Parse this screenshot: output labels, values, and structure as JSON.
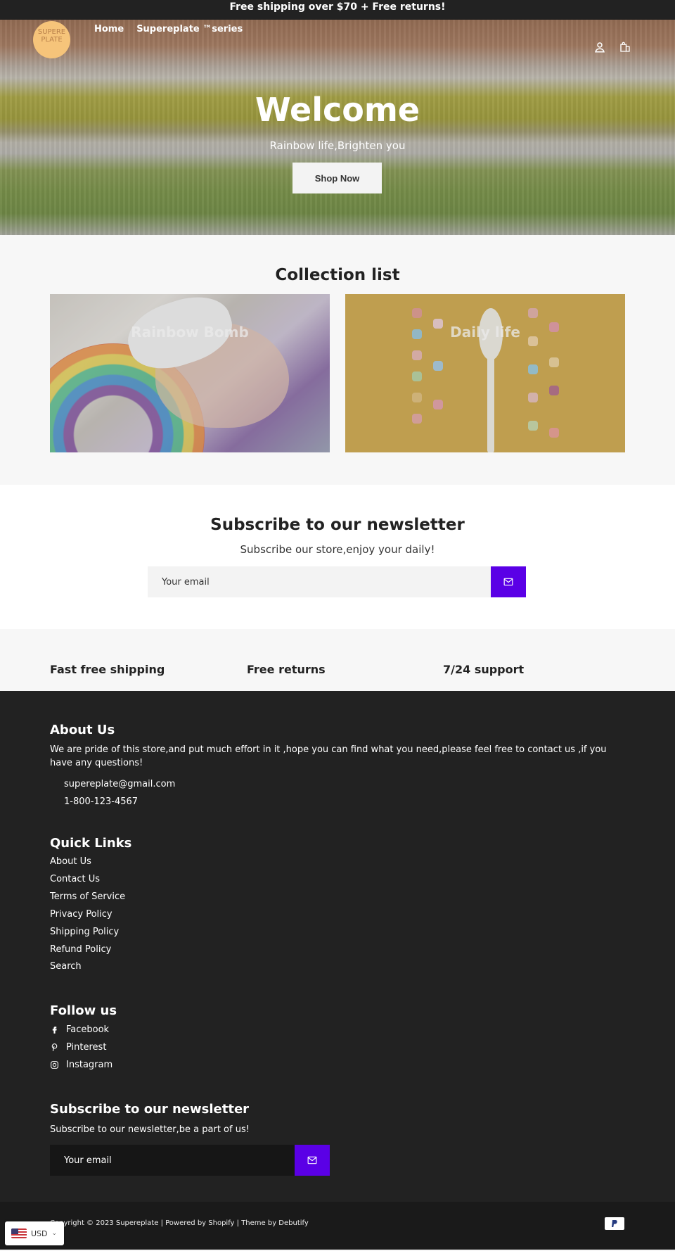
{
  "announcement": "Free shipping over $70 + Free returns!",
  "header": {
    "logo_line1": "SUPERE",
    "logo_line2": "PLATE",
    "nav": [
      {
        "label": "Home"
      },
      {
        "label": "Supereplate ™series"
      }
    ],
    "icons": [
      "account-icon",
      "cart-icon"
    ]
  },
  "hero": {
    "title": "Welcome",
    "subtitle": "Rainbow life,Brighten you",
    "button": "Shop Now"
  },
  "collections": {
    "title": "Collection list",
    "items": [
      {
        "label": "Rainbow Bomb"
      },
      {
        "label": "Daily life"
      }
    ]
  },
  "newsletter": {
    "title": "Subscribe to our newsletter",
    "subtitle": "Subscribe our store,enjoy your daily!",
    "placeholder": "Your email"
  },
  "features": [
    {
      "label": "Fast free shipping"
    },
    {
      "label": "Free returns"
    },
    {
      "label": "7/24 support"
    }
  ],
  "footer": {
    "about_title": "About Us",
    "about_text": "We are pride of this store,and put much effort in it ,hope you can find what you need,please feel free to contact us ,if you have any questions!",
    "email": "supereplate@gmail.com",
    "phone": "1-800-123-4567",
    "links_title": "Quick Links",
    "links": [
      {
        "label": "About Us"
      },
      {
        "label": "Contact Us"
      },
      {
        "label": "Terms of Service"
      },
      {
        "label": "Privacy Policy"
      },
      {
        "label": "Shipping Policy"
      },
      {
        "label": "Refund Policy"
      },
      {
        "label": "Search"
      }
    ],
    "follow_title": "Follow us",
    "social": [
      {
        "label": "Facebook",
        "icon": "facebook-icon"
      },
      {
        "label": "Pinterest",
        "icon": "pinterest-icon"
      },
      {
        "label": "Instagram",
        "icon": "instagram-icon"
      }
    ],
    "newsletter_title": "Subscribe to our newsletter",
    "newsletter_text": "Subscribe to our newsletter,be a part of us!",
    "newsletter_placeholder": "Your email",
    "copyright": "Copyright © 2023 Supereplate | Powered by Shopify | Theme by Debutify"
  },
  "currency": {
    "code": "USD"
  },
  "colors": {
    "accent": "#5a00e6",
    "dark": "#222222",
    "light_bg": "#f7f7f7"
  }
}
